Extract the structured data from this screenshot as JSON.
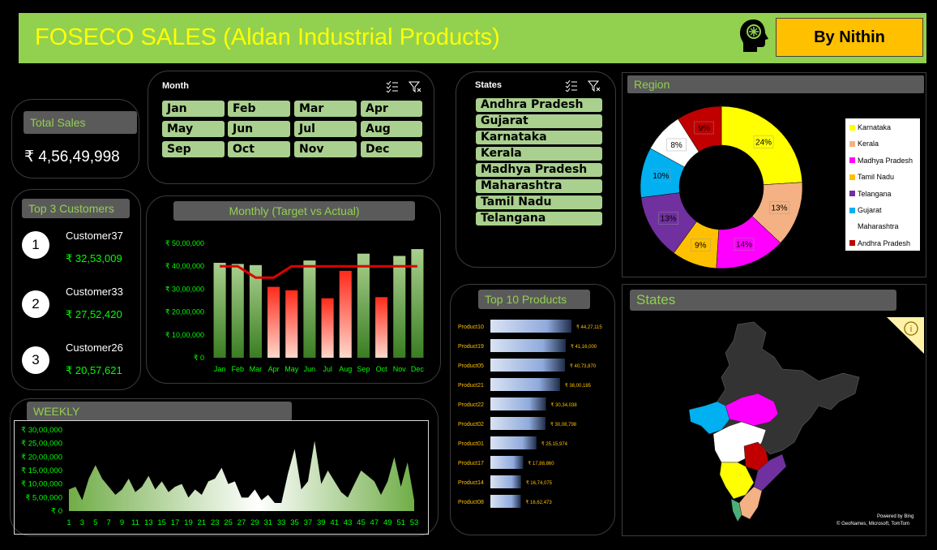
{
  "header": {
    "title": "FOSECO SALES (Aldan Industrial Products)",
    "author": "By Nithin",
    "icon": "brain-head-icon",
    "bg_color": "#92d050",
    "title_color": "#ffff00",
    "author_bg": "#ffc000"
  },
  "total_sales": {
    "label": "Total Sales",
    "value": "₹ 4,56,49,998"
  },
  "month_slicer": {
    "title": "Month",
    "items": [
      "Jan",
      "Feb",
      "Mar",
      "Apr",
      "May",
      "Jun",
      "Jul",
      "Aug",
      "Sep",
      "Oct",
      "Nov",
      "Dec"
    ]
  },
  "states_slicer": {
    "title": "States",
    "items": [
      "Andhra Pradesh",
      "Gujarat",
      "Karnataka",
      "Kerala",
      "Madhya Pradesh",
      "Maharashtra",
      "Tamil Nadu",
      "Telangana"
    ]
  },
  "top_customers": {
    "title": "Top 3 Customers",
    "items": [
      {
        "rank": "1",
        "name": "Customer37",
        "value": "₹ 32,53,009"
      },
      {
        "rank": "2",
        "name": "Customer33",
        "value": "₹ 27,52,420"
      },
      {
        "rank": "3",
        "name": "Customer26",
        "value": "₹ 20,57,621"
      }
    ]
  },
  "region": {
    "title": "Region"
  },
  "states_map": {
    "title": "States",
    "credit_line1": "Powered by Bing",
    "credit_line2": "© GeoNames, Microsoft, TomTom"
  },
  "weekly": {
    "title": "WEEKLY"
  },
  "chart_data": [
    {
      "id": "monthly",
      "type": "bar",
      "title": "Monthly (Target vs Actual)",
      "categories": [
        "Jan",
        "Feb",
        "Mar",
        "Apr",
        "May",
        "Jun",
        "Jul",
        "Aug",
        "Sep",
        "Oct",
        "Nov",
        "Dec"
      ],
      "yticks": [
        "₹ 0",
        "₹ 10,00,000",
        "₹ 20,00,000",
        "₹ 30,00,000",
        "₹ 40,00,000",
        "₹ 50,00,000"
      ],
      "ylim": [
        0,
        5000000
      ],
      "series": [
        {
          "name": "Actual",
          "values": [
            4150000,
            4100000,
            4050000,
            3100000,
            2950000,
            4250000,
            2600000,
            3800000,
            4550000,
            2650000,
            4450000,
            4750000
          ]
        },
        {
          "name": "Target",
          "values": [
            4000000,
            4000000,
            3500000,
            3500000,
            4000000,
            4000000,
            4000000,
            4000000,
            4000000,
            4000000,
            4000000,
            4000000
          ]
        }
      ],
      "above_target_color": "#70ad47",
      "below_target_color": "#ff3b30",
      "target_line_color": "#e00000"
    },
    {
      "id": "region",
      "type": "pie",
      "labels": [
        "Karnataka",
        "Kerala",
        "Madhya Pradesh",
        "Tamil Nadu",
        "Telangana",
        "Gujarat",
        "Maharashtra",
        "Andhra Pradesh"
      ],
      "values": [
        24,
        13,
        14,
        9,
        13,
        10,
        8,
        9
      ],
      "value_labels": [
        "24%",
        "13%",
        "14%",
        "9%",
        "13%",
        "10%",
        "8%",
        "9%"
      ],
      "colors": [
        "#ffff00",
        "#f4b183",
        "#ff00ff",
        "#ffc000",
        "#7030a0",
        "#00b0f0",
        "#ffffff",
        "#c00000"
      ],
      "legend_position": "right"
    },
    {
      "id": "top10",
      "type": "bar",
      "orientation": "horizontal",
      "title": "Top 10 Products",
      "categories": [
        "Product10",
        "Product19",
        "Product05",
        "Product21",
        "Product22",
        "Product02",
        "Product01",
        "Product17",
        "Product14",
        "Product08"
      ],
      "values": [
        4427115,
        4116000,
        4073870,
        3800185,
        3034038,
        3008798,
        2515974,
        1788860,
        1674075,
        1662473
      ],
      "value_labels": [
        "₹ 44,27,115",
        "₹ 41,16,000",
        "₹ 40,73,870",
        "₹ 38,00,185",
        "₹ 30,34,038",
        "₹ 30,08,798",
        "₹ 25,15,974",
        "₹ 17,88,860",
        "₹ 16,74,075",
        "₹ 16,62,473"
      ]
    },
    {
      "id": "weekly",
      "type": "area",
      "x": [
        1,
        2,
        3,
        4,
        5,
        6,
        7,
        8,
        9,
        10,
        11,
        12,
        13,
        14,
        15,
        16,
        17,
        18,
        19,
        20,
        21,
        22,
        23,
        24,
        25,
        26,
        27,
        28,
        29,
        30,
        31,
        32,
        33,
        34,
        35,
        36,
        37,
        38,
        39,
        40,
        41,
        42,
        43,
        44,
        45,
        46,
        47,
        48,
        49,
        50,
        51,
        52,
        53
      ],
      "xticks": [
        "1",
        "3",
        "5",
        "7",
        "9",
        "11",
        "13",
        "15",
        "17",
        "19",
        "21",
        "23",
        "25",
        "27",
        "29",
        "31",
        "33",
        "35",
        "37",
        "39",
        "41",
        "43",
        "45",
        "47",
        "49",
        "51",
        "53"
      ],
      "yticks": [
        "₹ 0",
        "₹ 5,00,000",
        "₹ 10,00,000",
        "₹ 15,00,000",
        "₹ 20,00,000",
        "₹ 25,00,000",
        "₹ 30,00,000"
      ],
      "ylim": [
        0,
        3000000
      ],
      "values": [
        800000,
        900000,
        400000,
        1200000,
        1700000,
        1200000,
        900000,
        600000,
        800000,
        1200000,
        700000,
        900000,
        1300000,
        800000,
        1100000,
        700000,
        900000,
        1000000,
        500000,
        800000,
        600000,
        1100000,
        1200000,
        1600000,
        1000000,
        1100000,
        500000,
        500000,
        800000,
        400000,
        600000,
        300000,
        300000,
        1400000,
        2300000,
        800000,
        1100000,
        2600000,
        1000000,
        1500000,
        1100000,
        700000,
        500000,
        1000000,
        1500000,
        1300000,
        1100000,
        600000,
        1100000,
        2000000,
        900000,
        1800000,
        400000
      ],
      "fill_color": "#70ad47"
    }
  ]
}
